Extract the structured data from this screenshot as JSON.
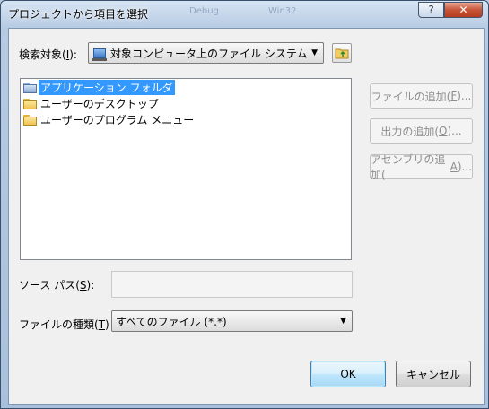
{
  "window": {
    "title": "プロジェクトから項目を選択",
    "background_hints": [
      "Debug",
      "Win32"
    ],
    "help_glyph": "?",
    "close_glyph": "✕"
  },
  "search_target": {
    "label_prefix": "検索対象(",
    "label_mnemonic": "I",
    "label_suffix": "):",
    "value": "対象コンピュータ上のファイル システム",
    "icon": "drive-icon"
  },
  "locations": {
    "items": [
      {
        "label": "アプリケーション フォルダ",
        "icon": "application-folder-icon",
        "selected": true
      },
      {
        "label": "ユーザーのデスクトップ",
        "icon": "folder-icon",
        "selected": false
      },
      {
        "label": "ユーザーのプログラム メニュー",
        "icon": "folder-icon",
        "selected": false
      }
    ]
  },
  "side_buttons": {
    "add_file": {
      "prefix": "ファイルの追加(",
      "mnemonic": "F",
      "suffix": ")..."
    },
    "add_output": {
      "prefix": "出力の追加(",
      "mnemonic": "O",
      "suffix": ")..."
    },
    "add_assembly": {
      "prefix": "アセンブリの追加(",
      "mnemonic": "A",
      "suffix": ")..."
    }
  },
  "source_path": {
    "label_prefix": "ソース パス(",
    "label_mnemonic": "S",
    "label_suffix": "):",
    "value": ""
  },
  "file_type": {
    "label_prefix": "ファイルの種類(",
    "label_mnemonic": "T",
    "label_suffix": ")",
    "value": "すべてのファイル (*.*)"
  },
  "footer": {
    "ok": "OK",
    "cancel": "キャンセル"
  },
  "colors": {
    "selection": "#3399ff",
    "disabled_text": "#8d8d8d"
  }
}
